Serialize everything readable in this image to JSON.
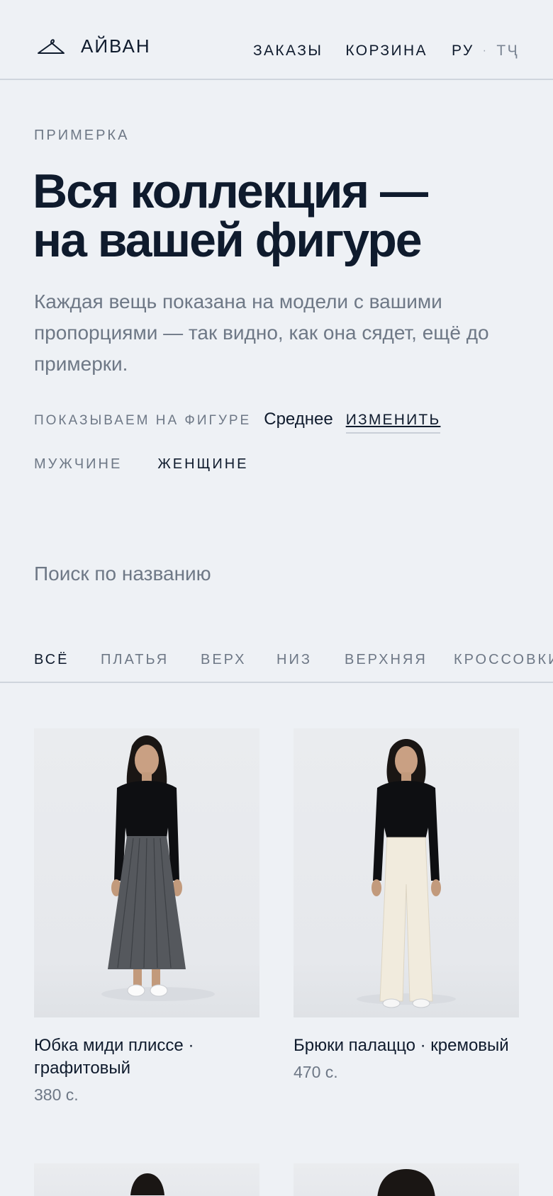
{
  "header": {
    "brand": "АЙВАН",
    "nav": {
      "orders": "ЗАКАЗЫ",
      "cart": "КОРЗИНА",
      "lang_active": "РУ",
      "lang_sep": "·",
      "lang_other": "ТҶ"
    }
  },
  "hero": {
    "eyebrow": "ПРИМЕРКА",
    "title_line1": "Вся коллекция —",
    "title_line2": "на вашей фигуре",
    "lead": "Каждая вещь показана на модели с вашими пропорциями — так видно, как она сядет, ещё до примерки."
  },
  "figure": {
    "label": "ПОКАЗЫВАЕМ НА ФИГУРЕ",
    "value": "Среднее",
    "change": "ИЗМЕНИТЬ"
  },
  "gender": {
    "men": "МУЖЧИНЕ",
    "women": "ЖЕНЩИНЕ",
    "selected": "women"
  },
  "search": {
    "placeholder": "Поиск по названию",
    "value": ""
  },
  "tabs": [
    {
      "label": "ВСЁ",
      "active": true
    },
    {
      "label": "ПЛАТЬЯ",
      "active": false
    },
    {
      "label": "ВЕРХ",
      "active": false
    },
    {
      "label": "НИЗ",
      "active": false
    },
    {
      "label": "ВЕРХНЯЯ",
      "active": false
    },
    {
      "label": "КРОССОВКИ",
      "active": false
    }
  ],
  "products": [
    {
      "name": "Юбка миди плиссе · графитовый",
      "price": "380 с.",
      "bottom_color": "#55585d",
      "top_color": "#0e0f12"
    },
    {
      "name": "Брюки палаццо · кремовый",
      "price": "470 с.",
      "bottom_color": "#f1ebdd",
      "top_color": "#0e0f12"
    }
  ],
  "colors": {
    "ink": "#0f1b2d",
    "muted": "#6e7886",
    "background": "#eef1f5",
    "divider": "#cfd5dd"
  }
}
